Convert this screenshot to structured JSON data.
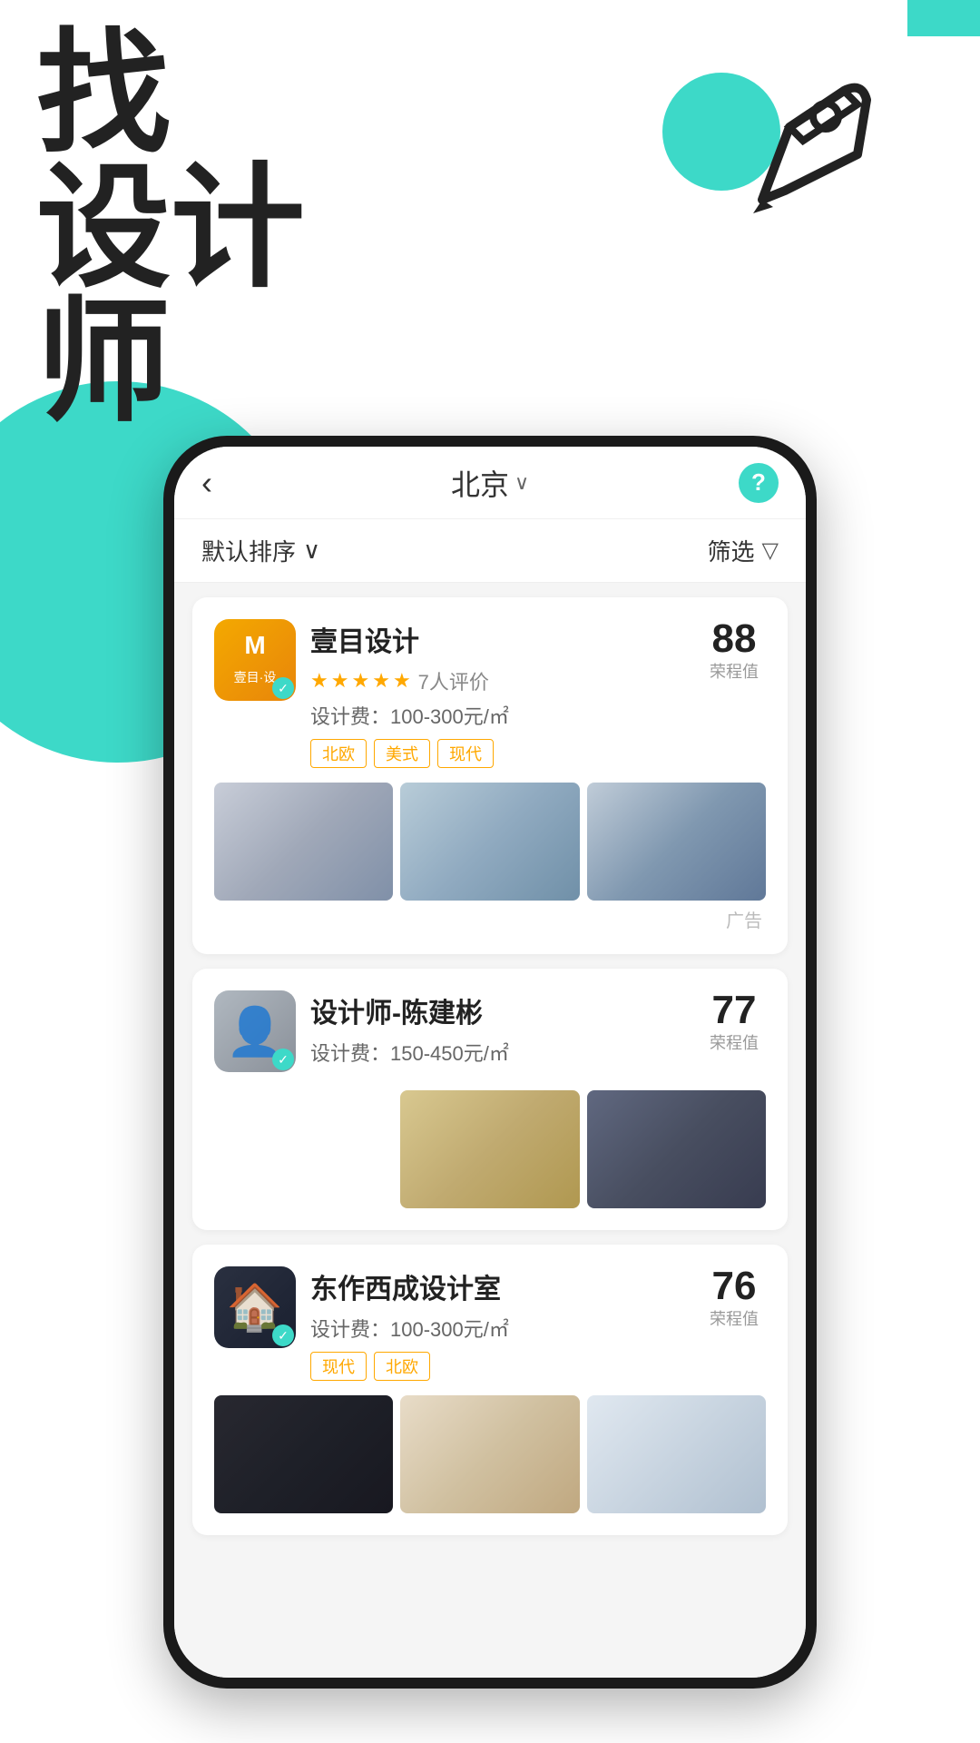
{
  "meta": {
    "title": "找设计师"
  },
  "background": {
    "rect_color": "#3DD9C8",
    "circle_large_color": "#3DD9C8",
    "circle_small_color": "#3DD9C8"
  },
  "hero": {
    "line1": "找",
    "line2": "设计",
    "line3": "师"
  },
  "header": {
    "back_icon": "‹",
    "city": "北京",
    "city_chevron": "∨",
    "help_icon": "?",
    "filter_sort": "默认排序",
    "filter_sort_chevron": "∨",
    "filter_label": "筛选",
    "filter_icon": "▽"
  },
  "designers": [
    {
      "id": 1,
      "name": "壹目设计",
      "stars": 5,
      "review_count": "7人评价",
      "price": "设计费：100-300元/㎡",
      "tags": [
        "北欧",
        "美式",
        "现代"
      ],
      "score": 88,
      "score_label": "荣程值",
      "is_ad": true,
      "avatar_type": "logo",
      "avatar_text": "M\n壹目·设"
    },
    {
      "id": 2,
      "name": "设计师-陈建彬",
      "stars": 0,
      "review_count": "",
      "price": "设计费：150-450元/㎡",
      "tags": [],
      "score": 77,
      "score_label": "荣程值",
      "is_ad": false,
      "avatar_type": "person",
      "avatar_text": "👤"
    },
    {
      "id": 3,
      "name": "东作西成设计室",
      "stars": 0,
      "review_count": "",
      "price": "设计费：100-300元/㎡",
      "tags": [
        "现代",
        "北欧"
      ],
      "score": 76,
      "score_label": "荣程值",
      "is_ad": false,
      "avatar_type": "logo2",
      "avatar_text": "🏠"
    }
  ]
}
